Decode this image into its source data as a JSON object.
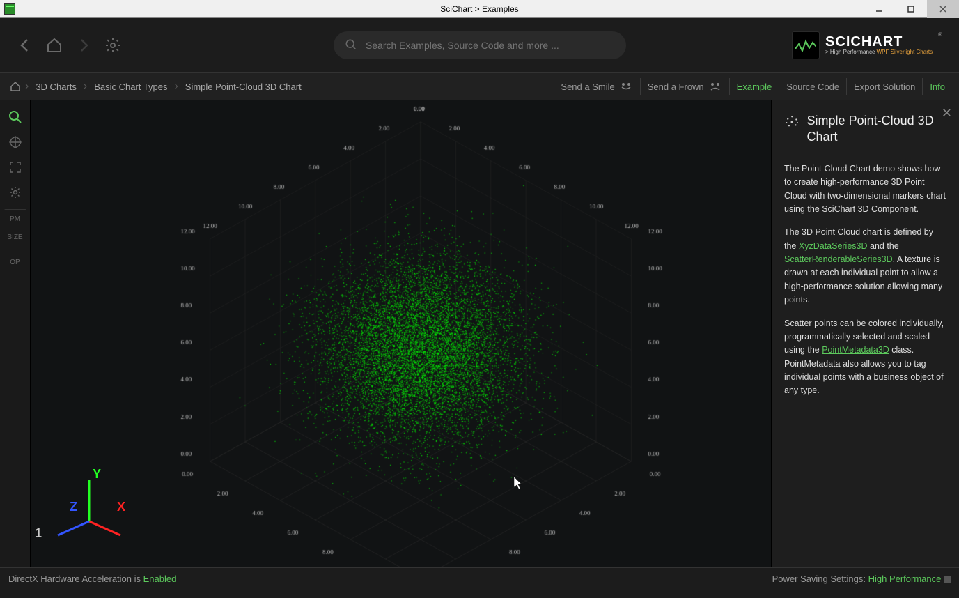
{
  "window": {
    "title": "SciChart > Examples"
  },
  "toolbar": {
    "search_placeholder": "Search Examples, Source Code and more ..."
  },
  "logo": {
    "name": "SCICHART",
    "tagline_prefix": "> High Performance ",
    "tagline_highlight": "WPF Silverlight Charts"
  },
  "breadcrumb": {
    "items": [
      "3D Charts",
      "Basic Chart Types",
      "Simple Point-Cloud 3D Chart"
    ]
  },
  "actions": {
    "smile": "Send a Smile",
    "frown": "Send a Frown",
    "example": "Example",
    "source": "Source Code",
    "export": "Export Solution",
    "info": "Info"
  },
  "side_tools": {
    "pm": "PM",
    "size": "SIZE",
    "op": "OP"
  },
  "info_panel": {
    "title": "Simple Point-Cloud 3D Chart",
    "p1": "The Point-Cloud Chart demo shows how to create high-performance 3D Point Cloud with two-dimensional markers chart using the SciChart 3D Component.",
    "p2a": "The 3D Point Cloud chart is defined by the ",
    "link1": "XyzDataSeries3D",
    "p2b": " and the ",
    "link2": "ScatterRenderableSeries3D",
    "p2c": ". A texture is drawn at each individual point to allow a high-performance solution allowing many points.",
    "p3a": "Scatter points can be colored individually, programmatically selected and scaled using the ",
    "link3": "PointMetadata3D",
    "p3b": " class. PointMetadata also allows you to tag individual points with a business object of any type."
  },
  "status": {
    "hw_label": "DirectX Hardware Acceleration is ",
    "hw_value": "Enabled",
    "ps_label": "Power Saving Settings: ",
    "ps_value": "High Performance"
  },
  "chart_data": {
    "type": "scatter",
    "dimensions": 3,
    "axis_ticks": [
      "0.00",
      "2.00",
      "4.00",
      "6.00",
      "8.00",
      "10.00",
      "12.00"
    ],
    "x_range": [
      0,
      12
    ],
    "y_range": [
      0,
      12
    ],
    "z_range": [
      0,
      12
    ],
    "point_count_approx": 10000,
    "distribution": "gaussian",
    "center": [
      5.5,
      5.5,
      5.5
    ],
    "spread": 2.0,
    "color": "#00ff00",
    "gizmo_labels": {
      "x": "X",
      "y": "Y",
      "z": "Z"
    },
    "counter": "1"
  }
}
